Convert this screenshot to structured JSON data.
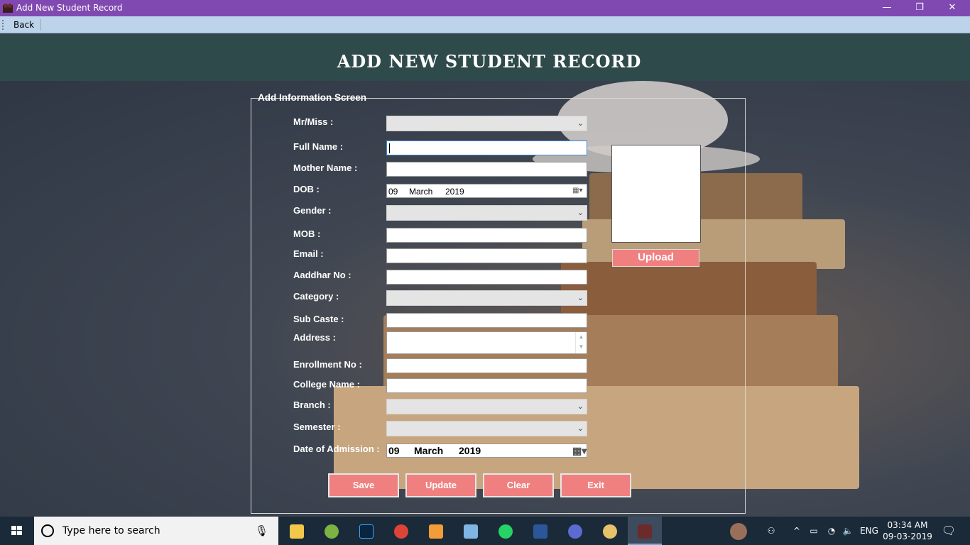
{
  "window": {
    "title": "Add New Student Record",
    "controls": {
      "minimize": "—",
      "restore": "❐",
      "close": "✕"
    }
  },
  "toolbar": {
    "back_label": "Back"
  },
  "page": {
    "heading": "ADD NEW STUDENT RECORD"
  },
  "form": {
    "group_title": "Add Information Screen",
    "labels": {
      "salutation": "Mr/Miss :",
      "full_name": "Full Name :",
      "mother_name": "Mother Name :",
      "dob": "DOB :",
      "gender": "Gender :",
      "mob": "MOB :",
      "email": "Email :",
      "aadhar": "Aaddhar No :",
      "category": "Category :",
      "sub_caste": "Sub Caste :",
      "address": "Address :",
      "enrollment": "Enrollment No :",
      "college": "College Name :",
      "branch": "Branch :",
      "semester": "Semester :",
      "admission_date": "Date of Admission :"
    },
    "values": {
      "salutation": "",
      "full_name": "",
      "mother_name": "",
      "gender": "",
      "mob": "",
      "email": "",
      "aadhar": "",
      "category": "",
      "sub_caste": "",
      "address": "",
      "enrollment": "",
      "college": "",
      "branch": "",
      "semester": ""
    },
    "dob": {
      "day": "09",
      "month": "March",
      "year": "2019"
    },
    "admission_date": {
      "day": "09",
      "month": "March",
      "year": "2019"
    },
    "upload_label": "Upload",
    "buttons": {
      "save": "Save",
      "update": "Update",
      "clear": "Clear",
      "exit": "Exit"
    }
  },
  "taskbar": {
    "search_placeholder": "Type here to search",
    "pinned": [
      "file-explorer",
      "android-studio",
      "photoshop",
      "chrome",
      "media-player",
      "3d-box",
      "whatsapp",
      "word",
      "infinity-app",
      "paint",
      "student-app"
    ],
    "tray": {
      "language": "ENG",
      "time": "03:34 AM",
      "date": "09-03-2019"
    }
  },
  "colors": {
    "titlebar": "#8049b1",
    "toolbar": "#bcd3ea",
    "header": "#2f4a4a",
    "button": "#f08080",
    "taskbar": "#1b2a38"
  }
}
